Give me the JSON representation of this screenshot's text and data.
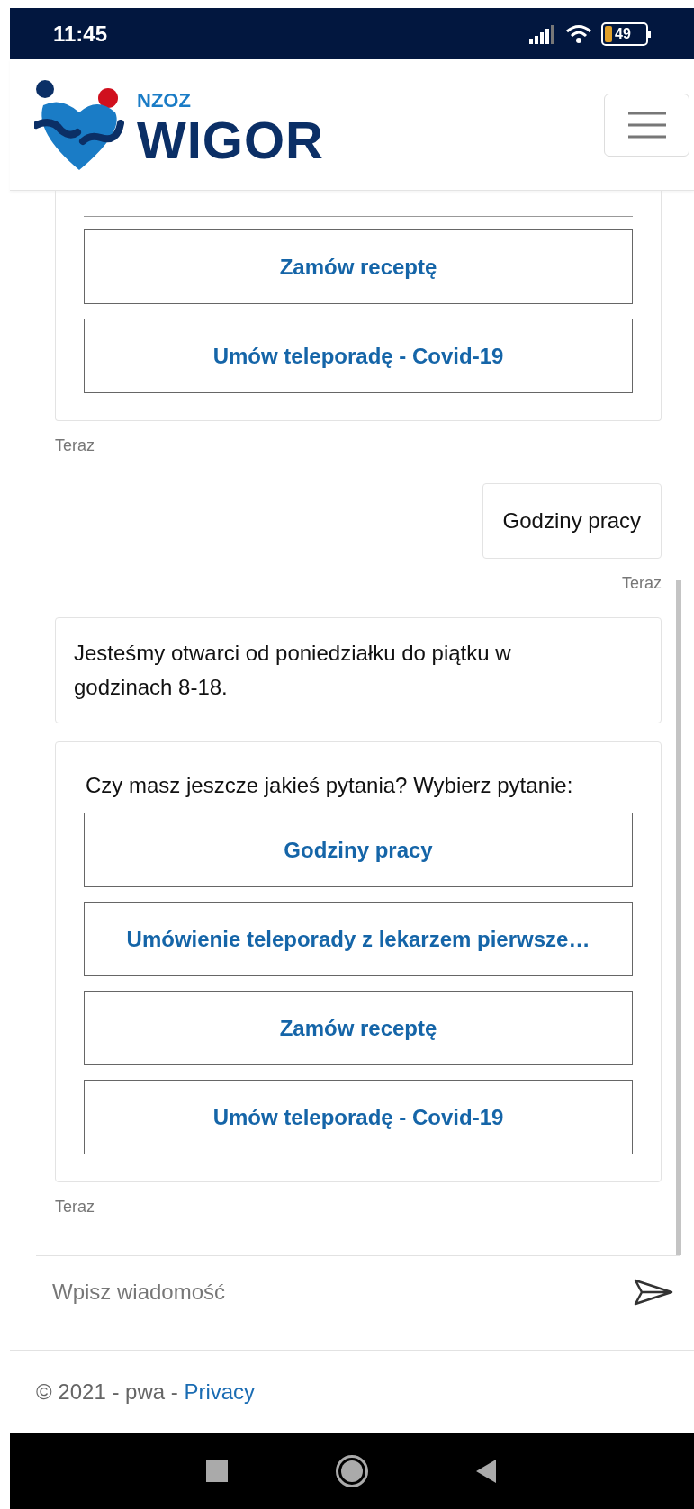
{
  "status_bar": {
    "time": "11:45",
    "battery": "49"
  },
  "header": {
    "logo_small": "NZOZ",
    "logo_large": "WIGOR"
  },
  "messages": [
    {
      "kind": "options",
      "cut_top": true,
      "buttons": [
        "Zamów receptę",
        "Umów teleporadę - Covid-19"
      ],
      "time": "Teraz"
    },
    {
      "kind": "user",
      "text": "Godziny pracy",
      "time": "Teraz"
    },
    {
      "kind": "bot",
      "text": "Jesteśmy otwarci od poniedziałku do piątku w godzinach 8-18."
    },
    {
      "kind": "options",
      "cut_top": false,
      "prompt": "Czy masz jeszcze jakieś pytania? Wybierz pytanie:",
      "buttons": [
        "Godziny pracy",
        "Umówienie teleporady z lekarzem pierwsze…",
        "Zamów receptę",
        "Umów teleporadę - Covid-19"
      ],
      "time": "Teraz"
    }
  ],
  "composer": {
    "placeholder": "Wpisz wiadomość"
  },
  "footer": {
    "text": "© 2021 - pwa - ",
    "link": "Privacy"
  }
}
